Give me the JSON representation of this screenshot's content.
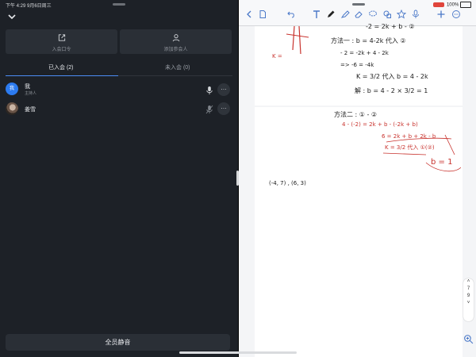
{
  "status_bar": {
    "left_text": "下午 4:29   9月6日周三",
    "battery": "100%"
  },
  "meeting": {
    "actions": [
      {
        "label": "入会口令",
        "icon": "share-icon"
      },
      {
        "label": "添加参会人",
        "icon": "add-person-icon"
      }
    ],
    "tabs": [
      {
        "label": "已入会 (2)",
        "active": true
      },
      {
        "label": "未入会 (0)",
        "active": false
      }
    ],
    "participants": [
      {
        "avatar": "我",
        "name": "我",
        "role": "主持人"
      },
      {
        "avatar": "",
        "name": "姜雪",
        "role": ""
      }
    ],
    "mute_all_label": "全员静音"
  },
  "notes": {
    "page1_lines": [
      "-2  =  2k + b  - ②",
      "方法一 : b = 4-2k  代入 ②",
      "- 2 = -2k + 4 - 2k",
      "=> -6 = -4k",
      "K = 3/2  代入 b = 4 - 2k",
      "解 : b = 4 - 2 × 3/2 = 1",
      "K ="
    ],
    "page2_lines": [
      "方法二 : ① - ②",
      "4 - (-2) = 2k + b - (-2k + b)",
      "6 = 2k + b + 2k - b",
      "K = 3/2  代入 ①(②)",
      "b = 1",
      "(-4, 7) , (6, 3)"
    ],
    "page_numbers": [
      "7",
      "9"
    ]
  },
  "colors": {
    "accent": "#4c8df6",
    "ink_red": "#c8322d",
    "ink_black": "#1a1a1a"
  }
}
